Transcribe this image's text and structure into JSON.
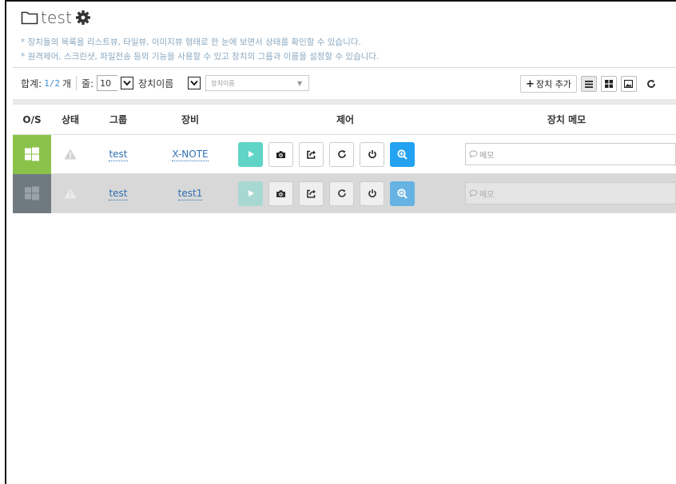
{
  "header": {
    "title": "test",
    "desc1": "* 장치들의 목록을 리스트뷰, 타일뷰, 이미지뷰 형태로 한 눈에 보면서 상태를 확인할 수 있습니다.",
    "desc2": "* 원격제어, 스크린샷, 파일전송 등의 기능을 사용할 수 있고 장치의 그룹과 이름을 설정할 수 있습니다."
  },
  "toolbar": {
    "total_label": "합계:",
    "total_value": "1/2",
    "total_unit": "개",
    "rows_label": "줄:",
    "rows_value": "10",
    "sort_value": "장치이름",
    "search_placeholder": "장치이름",
    "add_label": "장치 추가"
  },
  "table": {
    "columns": {
      "os": "O/S",
      "status": "상태",
      "group": "그룹",
      "device": "장비",
      "control": "제어",
      "memo": "장치 메모"
    },
    "rows": [
      {
        "os": "windows-icon",
        "online": true,
        "group": "test",
        "device": "X-NOTE",
        "memo_placeholder": "메모"
      },
      {
        "os": "windows-icon",
        "online": false,
        "group": "test",
        "device": "test1",
        "memo_placeholder": "메모"
      }
    ]
  },
  "colors": {
    "online_os_bg": "#8bc34a",
    "offline_os_bg": "#6f7a80",
    "play_button": "#5fd4c7",
    "zoom_button": "#22a2f0",
    "link": "#2f6fb2",
    "description": "#8aa8c0"
  }
}
